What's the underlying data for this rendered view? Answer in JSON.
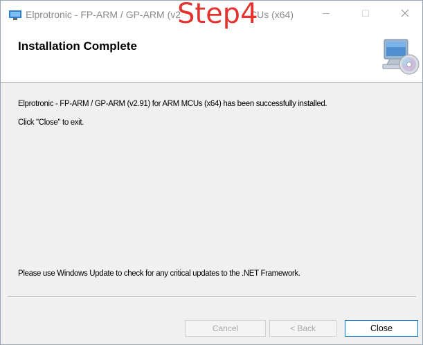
{
  "window": {
    "title": "Elprotronic - FP-ARM / GP-ARM (v2.91) for ARM MCUs (x64)",
    "title_visible_left": "Elprotronic - FP-ARM / GP-ARM (v2",
    "title_visible_right": "CUs (x64)",
    "overlay_text": "Step4",
    "overlay_color": "#e6322e",
    "app_icon": "installer-icon",
    "controls": {
      "minimize_icon": "minimize-icon",
      "maximize_icon": "maximize-icon",
      "close_icon": "close-icon"
    }
  },
  "banner": {
    "title": "Installation Complete",
    "icon": "computer-disc-icon"
  },
  "body": {
    "message_installed": "Elprotronic - FP-ARM / GP-ARM (v2.91) for ARM MCUs (x64) has been successfully installed.",
    "message_exit": "Click \"Close\" to exit.",
    "message_update": "Please use Windows Update to check for any critical updates to the .NET Framework."
  },
  "buttons": {
    "cancel": "Cancel",
    "back": "< Back",
    "close": "Close"
  },
  "colors": {
    "accent_border": "#0078d7",
    "disabled_text": "#a7a7a7"
  }
}
